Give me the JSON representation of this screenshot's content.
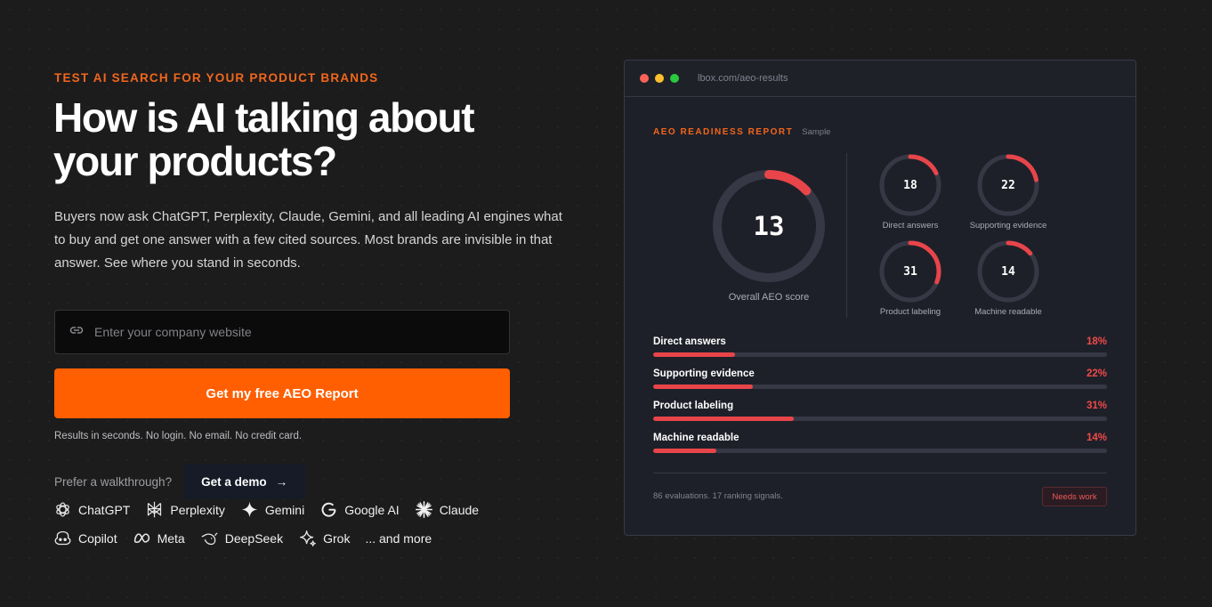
{
  "hero": {
    "eyebrow": "TEST AI SEARCH FOR YOUR PRODUCT BRANDS",
    "headline_line1": "How is AI talking about",
    "headline_line2": "your products?",
    "subtext": "Buyers now ask ChatGPT, Perplexity, Claude, Gemini, and all leading AI engines what to buy and get one answer with a few cited sources. Most brands are invisible in that answer. See where you stand in seconds."
  },
  "form": {
    "url_placeholder": "Enter your company website",
    "url_value": "",
    "cta_label": "Get my free AEO Report",
    "fineprint": "Results in seconds. No login. No email. No credit card."
  },
  "walkthrough": {
    "label": "Prefer a walkthrough?",
    "demo_label": "Get a demo",
    "demo_arrow": "→"
  },
  "engines": {
    "row1": [
      {
        "icon": "chatgpt-icon",
        "label": "ChatGPT"
      },
      {
        "icon": "perplexity-icon",
        "label": "Perplexity"
      },
      {
        "icon": "gemini-icon",
        "label": "Gemini"
      },
      {
        "icon": "google-icon",
        "label": "Google AI"
      },
      {
        "icon": "claude-icon",
        "label": "Claude"
      }
    ],
    "row2": [
      {
        "icon": "copilot-icon",
        "label": "Copilot"
      },
      {
        "icon": "meta-icon",
        "label": "Meta"
      },
      {
        "icon": "deepseek-icon",
        "label": "DeepSeek"
      },
      {
        "icon": "grok-icon",
        "label": "Grok"
      },
      {
        "label": "... and more"
      }
    ]
  },
  "report": {
    "url": "lbox.com/aeo-results",
    "title": "AEO READINESS REPORT",
    "sample": "Sample",
    "overall_score": "13",
    "overall_fraction": 0.13,
    "overall_label": "Overall AEO score",
    "metrics": [
      {
        "value": "18",
        "fraction": 0.18,
        "label": "Direct answers"
      },
      {
        "value": "22",
        "fraction": 0.22,
        "label": "Supporting evidence"
      },
      {
        "value": "31",
        "fraction": 0.31,
        "label": "Product labeling"
      },
      {
        "value": "14",
        "fraction": 0.14,
        "label": "Machine readable"
      }
    ],
    "bars": [
      {
        "name": "Direct answers",
        "pct": "18%",
        "fraction": 0.18
      },
      {
        "name": "Supporting evidence",
        "pct": "22%",
        "fraction": 0.22
      },
      {
        "name": "Product labeling",
        "pct": "31%",
        "fraction": 0.31
      },
      {
        "name": "Machine readable",
        "pct": "14%",
        "fraction": 0.14
      }
    ],
    "footer_note": "86 evaluations. 17 ranking signals.",
    "badge": "Needs work"
  },
  "colors": {
    "accent": "#ff5f00",
    "eyebrow": "#f2661c",
    "gauge_red": "#e8454a",
    "gauge_track": "#363945",
    "dot_red": "#ff6259",
    "dot_yellow": "#ffbf2e",
    "dot_green": "#29c940"
  }
}
